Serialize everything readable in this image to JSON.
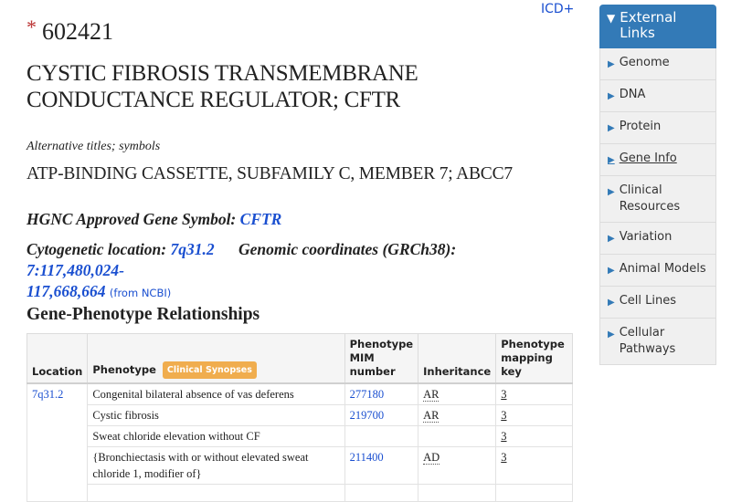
{
  "header": {
    "icd_link": "ICD+",
    "mim_prefix_symbol": "*",
    "mim_number": "602421",
    "title_line1": "CYSTIC FIBROSIS TRANSMEMBRANE",
    "title_line2": "CONDUCTANCE REGULATOR; CFTR",
    "alt_label": "Alternative titles; symbols",
    "alt_title": "ATP-BINDING CASSETTE, SUBFAMILY C, MEMBER 7; ABCC7"
  },
  "gene_info": {
    "hgnc_label": "HGNC Approved Gene Symbol:",
    "hgnc_symbol": "CFTR",
    "cyto_label": "Cytogenetic location:",
    "cyto_value": "7q31.2",
    "genomic_label": "Genomic coordinates (GRCh38):",
    "genomic_value_line1": "7:117,480,024-",
    "genomic_value_line2": "117,668,664",
    "genomic_source": "(from NCBI)"
  },
  "gpr": {
    "title": "Gene-Phenotype Relationships",
    "headers": {
      "location": "Location",
      "phenotype": "Phenotype",
      "clinical_badge": "Clinical Synopses",
      "mim": "Phenotype MIM number",
      "inheritance": "Inheritance",
      "mapping_key": "Phenotype mapping key"
    },
    "location": "7q31.2",
    "rows": [
      {
        "phenotype": "Congenital bilateral absence of vas deferens",
        "mim": "277180",
        "inheritance": "AR",
        "key": "3"
      },
      {
        "phenotype": "Cystic fibrosis",
        "mim": "219700",
        "inheritance": "AR",
        "key": "3"
      },
      {
        "phenotype": "Sweat chloride elevation without CF",
        "mim": "",
        "inheritance": "",
        "key": "3"
      },
      {
        "phenotype": "{Bronchiectasis with or without elevated sweat chloride 1, modifier of}",
        "mim": "211400",
        "inheritance": "AD",
        "key": "3"
      }
    ]
  },
  "sidebar": {
    "header": "External Links",
    "header_icon": "triangle-down",
    "items": [
      {
        "label": "Genome"
      },
      {
        "label": "DNA"
      },
      {
        "label": "Protein"
      },
      {
        "label": "Gene Info"
      },
      {
        "label": "Clinical Resources"
      },
      {
        "label": "Variation"
      },
      {
        "label": "Animal Models"
      },
      {
        "label": "Cell Lines"
      },
      {
        "label": "Cellular Pathways"
      }
    ]
  },
  "colors": {
    "link": "#1a4fd0",
    "sidebar_header": "#337ab7",
    "badge": "#f0ad4e",
    "star": "#b33333"
  }
}
